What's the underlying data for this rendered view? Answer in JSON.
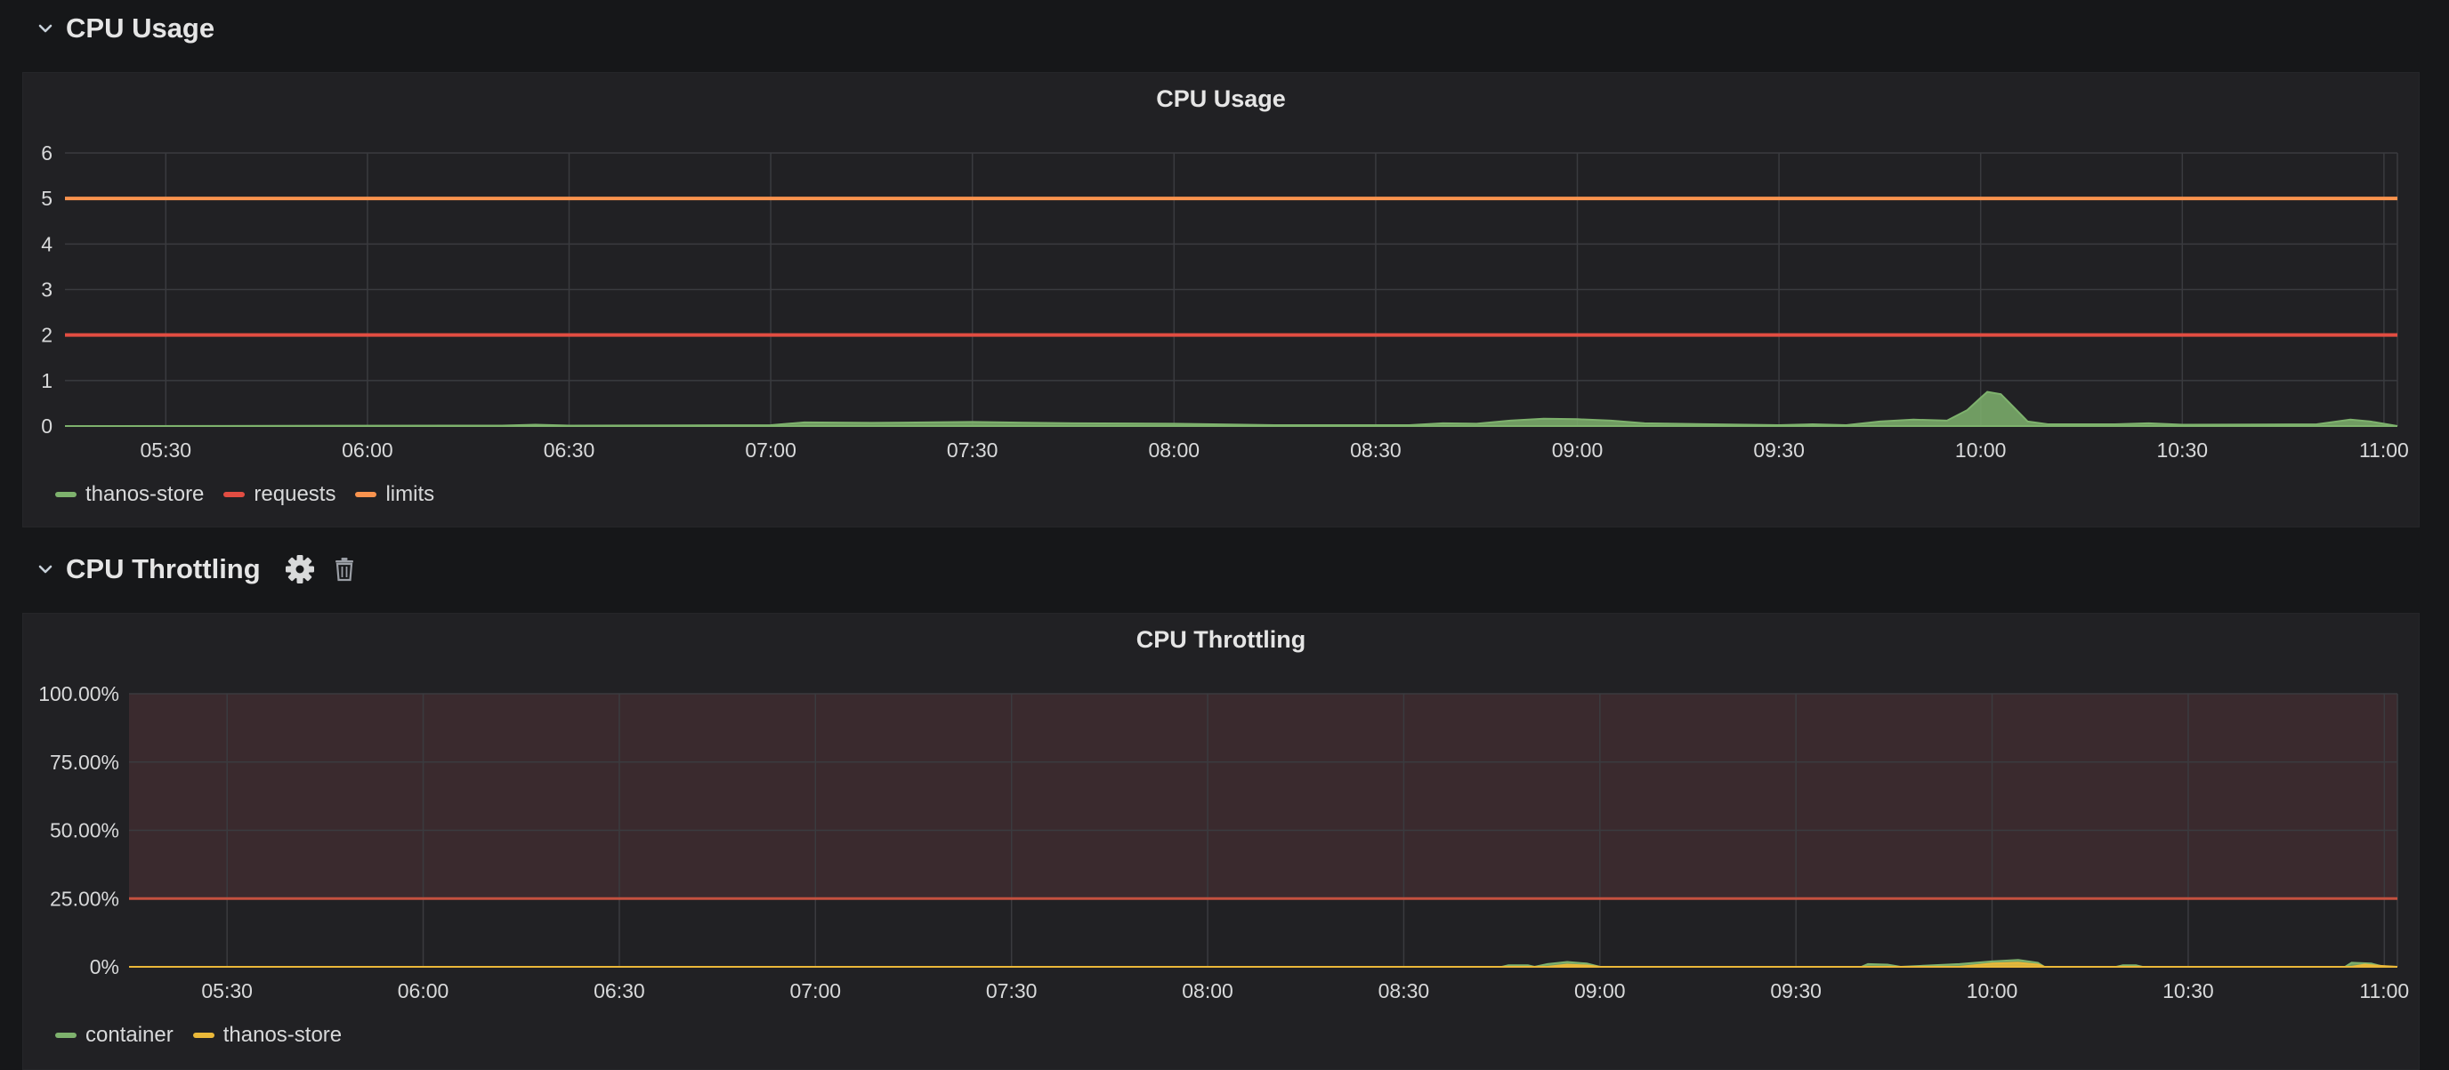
{
  "rows": [
    {
      "title": "CPU Usage"
    },
    {
      "title": "CPU Throttling",
      "icons": [
        "gear-icon",
        "trash-icon"
      ]
    }
  ],
  "panels": [
    {
      "title": "CPU Usage",
      "legend": [
        {
          "label": "thanos-store",
          "color": "#7eb26d"
        },
        {
          "label": "requests",
          "color": "#e24d42"
        },
        {
          "label": "limits",
          "color": "#f9934e"
        }
      ]
    },
    {
      "title": "CPU Throttling",
      "legend": [
        {
          "label": "container",
          "color": "#7eb26d"
        },
        {
          "label": "thanos-store",
          "color": "#eab839"
        }
      ]
    }
  ],
  "chart_data": [
    {
      "type": "area",
      "title": "CPU Usage",
      "x_ticks": [
        "05:30",
        "06:00",
        "06:30",
        "07:00",
        "07:30",
        "08:00",
        "08:30",
        "09:00",
        "09:30",
        "10:00",
        "10:30",
        "11:00"
      ],
      "y_ticks": [
        "0",
        "1",
        "2",
        "3",
        "4",
        "5",
        "6"
      ],
      "ylim": [
        0,
        6
      ],
      "x_range": [
        "05:15",
        "11:02"
      ],
      "grid": true,
      "legend_position": "bottom-left",
      "series": [
        {
          "name": "thanos-store",
          "color": "#7eb26d",
          "style": "area",
          "points": [
            [
              "05:15",
              0
            ],
            [
              "06:20",
              0.01
            ],
            [
              "06:25",
              0.03
            ],
            [
              "06:30",
              0.01
            ],
            [
              "07:00",
              0.02
            ],
            [
              "07:05",
              0.08
            ],
            [
              "07:15",
              0.07
            ],
            [
              "07:30",
              0.09
            ],
            [
              "07:45",
              0.06
            ],
            [
              "08:00",
              0.05
            ],
            [
              "08:15",
              0.02
            ],
            [
              "08:35",
              0.02
            ],
            [
              "08:40",
              0.06
            ],
            [
              "08:45",
              0.05
            ],
            [
              "08:50",
              0.12
            ],
            [
              "08:55",
              0.16
            ],
            [
              "09:00",
              0.15
            ],
            [
              "09:05",
              0.12
            ],
            [
              "09:10",
              0.06
            ],
            [
              "09:20",
              0.04
            ],
            [
              "09:25",
              0.03
            ],
            [
              "09:30",
              0.02
            ],
            [
              "09:35",
              0.04
            ],
            [
              "09:40",
              0.02
            ],
            [
              "09:45",
              0.1
            ],
            [
              "09:50",
              0.14
            ],
            [
              "09:55",
              0.12
            ],
            [
              "09:58",
              0.35
            ],
            [
              "10:00",
              0.62
            ],
            [
              "10:01",
              0.75
            ],
            [
              "10:03",
              0.7
            ],
            [
              "10:05",
              0.4
            ],
            [
              "10:07",
              0.1
            ],
            [
              "10:10",
              0.04
            ],
            [
              "10:20",
              0.04
            ],
            [
              "10:25",
              0.06
            ],
            [
              "10:30",
              0.03
            ],
            [
              "10:50",
              0.04
            ],
            [
              "10:55",
              0.14
            ],
            [
              "10:58",
              0.1
            ],
            [
              "11:02",
              0
            ]
          ]
        },
        {
          "name": "requests",
          "color": "#e24d42",
          "style": "line",
          "value": 2
        },
        {
          "name": "limits",
          "color": "#f9934e",
          "style": "line",
          "value": 5
        }
      ]
    },
    {
      "type": "area",
      "title": "CPU Throttling",
      "x_ticks": [
        "05:30",
        "06:00",
        "06:30",
        "07:00",
        "07:30",
        "08:00",
        "08:30",
        "09:00",
        "09:30",
        "10:00",
        "10:30",
        "11:00"
      ],
      "y_ticks": [
        "0%",
        "25.00%",
        "50.00%",
        "75.00%",
        "100.00%"
      ],
      "ylim": [
        0,
        1
      ],
      "x_range": [
        "05:15",
        "11:02"
      ],
      "grid": true,
      "legend_position": "bottom-left",
      "threshold": {
        "value": 0.25,
        "line_color": "#c4513f",
        "fill_color": "#3a2a2e"
      },
      "series": [
        {
          "name": "container",
          "color": "#7eb26d",
          "style": "area",
          "points": [
            [
              "05:15",
              0
            ],
            [
              "08:45",
              0
            ],
            [
              "08:46",
              0.006
            ],
            [
              "08:49",
              0.006
            ],
            [
              "08:50",
              0
            ],
            [
              "08:52",
              0.01
            ],
            [
              "08:55",
              0.018
            ],
            [
              "08:58",
              0.012
            ],
            [
              "09:00",
              0
            ],
            [
              "09:40",
              0
            ],
            [
              "09:41",
              0.01
            ],
            [
              "09:44",
              0.008
            ],
            [
              "09:46",
              0
            ],
            [
              "09:55",
              0.01
            ],
            [
              "10:00",
              0.02
            ],
            [
              "10:04",
              0.025
            ],
            [
              "10:07",
              0.015
            ],
            [
              "10:08",
              0
            ],
            [
              "10:19",
              0
            ],
            [
              "10:20",
              0.006
            ],
            [
              "10:22",
              0.006
            ],
            [
              "10:23",
              0
            ],
            [
              "10:54",
              0
            ],
            [
              "10:55",
              0.015
            ],
            [
              "10:58",
              0.012
            ],
            [
              "11:00",
              0
            ],
            [
              "11:02",
              0
            ]
          ]
        },
        {
          "name": "thanos-store",
          "color": "#eab839",
          "style": "area",
          "points": [
            [
              "05:15",
              0
            ],
            [
              "08:52",
              0
            ],
            [
              "08:55",
              0.008
            ],
            [
              "08:58",
              0.005
            ],
            [
              "09:00",
              0
            ],
            [
              "09:55",
              0
            ],
            [
              "10:00",
              0.012
            ],
            [
              "10:04",
              0.015
            ],
            [
              "10:07",
              0.008
            ],
            [
              "10:08",
              0
            ],
            [
              "10:55",
              0
            ],
            [
              "10:57",
              0.008
            ],
            [
              "10:59",
              0.004
            ],
            [
              "11:02",
              0
            ]
          ]
        }
      ]
    }
  ]
}
